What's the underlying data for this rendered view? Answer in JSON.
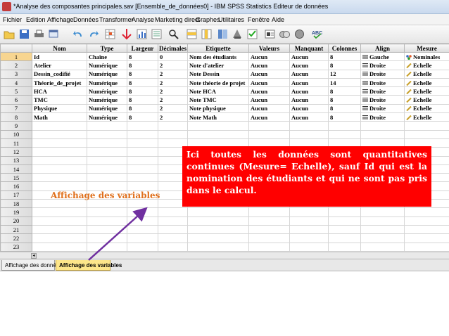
{
  "window": {
    "title": "*Analyse des composantes principales.sav [Ensemble_de_données0] - IBM SPSS Statistics Editeur de données"
  },
  "menu": [
    "Fichier",
    "Edition",
    "Affichage",
    "Données",
    "Transformer",
    "Analyse",
    "Marketing direct",
    "Graphes",
    "Utilitaires",
    "Fenêtre",
    "Aide"
  ],
  "toolbar": {
    "icons": [
      "open-folder",
      "save",
      "print",
      "dialog-recall",
      "undo",
      "redo",
      "goto-case",
      "goto-variable",
      "variables",
      "find",
      "insert-cases",
      "insert-variable",
      "split-file",
      "weight-cases",
      "select-cases",
      "value-labels",
      "use-sets",
      "show-all",
      "spell-check"
    ],
    "spell_label": "ABC"
  },
  "grid": {
    "headers": [
      "Nom",
      "Type",
      "Largeur",
      "Décimales",
      "Etiquette",
      "Valeurs",
      "Manquant",
      "Colonnes",
      "Align",
      "Mesure"
    ],
    "rows": [
      [
        "1",
        "Id",
        "Chaîne",
        "8",
        "0",
        "Nom des  étudiants",
        "Aucun",
        "Aucun",
        "8",
        "Gauche",
        "Nominales"
      ],
      [
        "2",
        "Atelier",
        "Numérique",
        "8",
        "2",
        "Note d'atelier",
        "Aucun",
        "Aucun",
        "8",
        "Droite",
        "Echelle"
      ],
      [
        "3",
        "Dessin_codifié",
        "Numérique",
        "8",
        "2",
        "Note  Dessin",
        "Aucun",
        "Aucun",
        "12",
        "Droite",
        "Echelle"
      ],
      [
        "4",
        "Théorie_de_projet",
        "Numérique",
        "8",
        "2",
        "Note théorie  de projet",
        "Aucun",
        "Aucun",
        "14",
        "Droite",
        "Echelle"
      ],
      [
        "5",
        "HCA",
        "Numérique",
        "8",
        "2",
        "Note HCA",
        "Aucun",
        "Aucun",
        "8",
        "Droite",
        "Echelle"
      ],
      [
        "6",
        "TMC",
        "Numérique",
        "8",
        "2",
        "Note TMC",
        "Aucun",
        "Aucun",
        "8",
        "Droite",
        "Echelle"
      ],
      [
        "7",
        "Physique",
        "Numérique",
        "8",
        "2",
        "Note physique",
        "Aucun",
        "Aucun",
        "8",
        "Droite",
        "Echelle"
      ],
      [
        "8",
        "Math",
        "Numérique",
        "8",
        "2",
        "Note Math",
        "Aucun",
        "Aucun",
        "8",
        "Droite",
        "Echelle"
      ]
    ],
    "empty_rows": [
      "9",
      "10",
      "11",
      "12",
      "13",
      "14",
      "15",
      "16",
      "17",
      "18",
      "19",
      "20",
      "21",
      "22",
      "23"
    ],
    "selected_row": "1"
  },
  "tabs": {
    "data_view": "Affichage des données",
    "variable_view": "Affichage des variables"
  },
  "annotation": {
    "callout": "Ici toutes les données sont quantitatives continues (Mesure= Echelle), sauf Id qui est la nomination des étudiants et qui ne sont pas pris dans le calcul.",
    "caption": "Affichage des  variables",
    "colors": {
      "callout_bg": "#ff0000",
      "caption": "#e0701c",
      "arrow": "#7030a0",
      "selected_tab": "#fde68a"
    }
  }
}
